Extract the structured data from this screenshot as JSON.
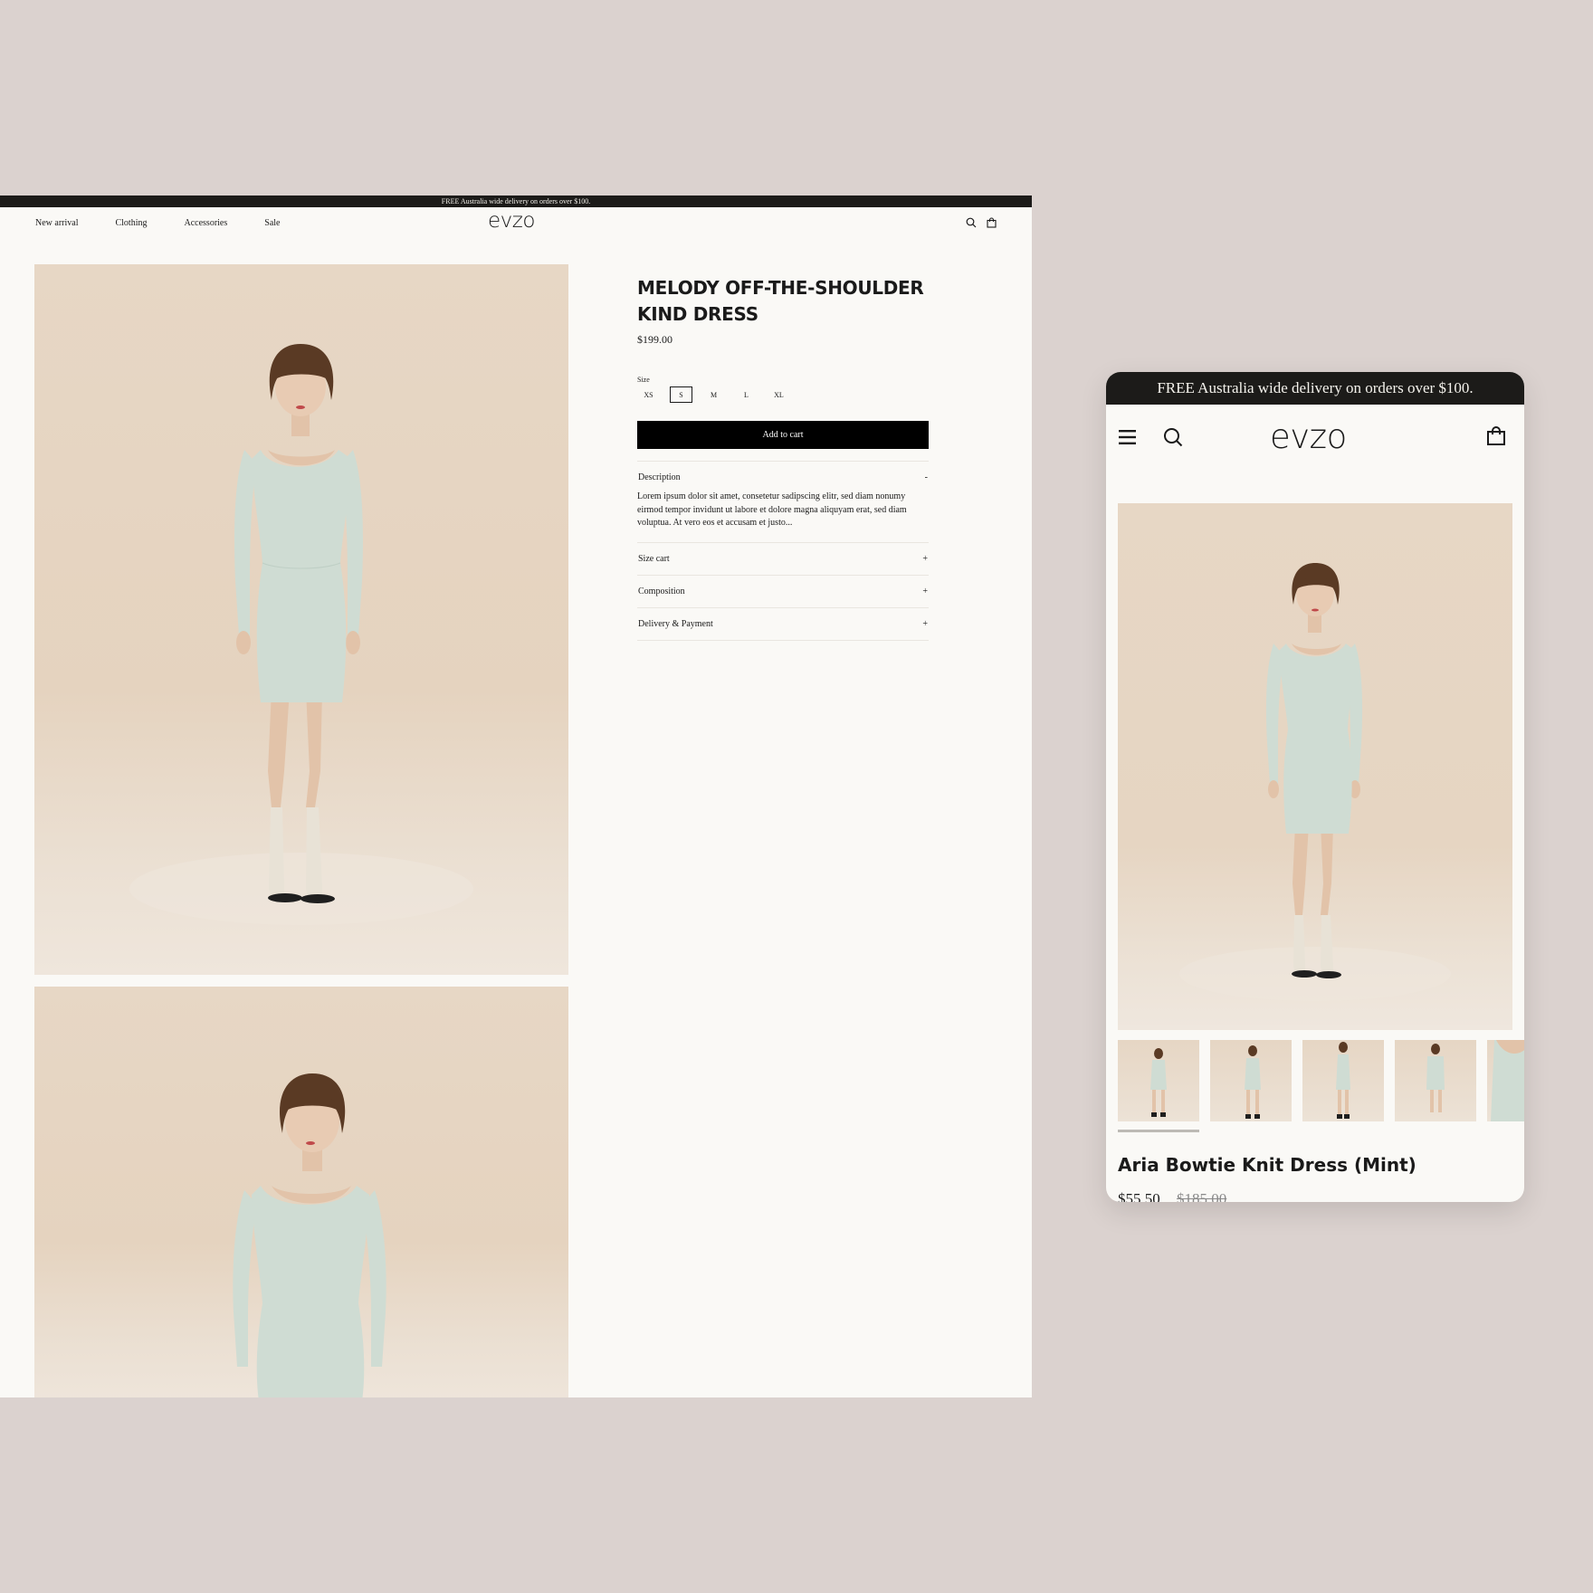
{
  "desktop": {
    "announcement": "FREE Australia wide delivery on orders over $100.",
    "nav": [
      {
        "label": "New arrival"
      },
      {
        "label": "Clothing"
      },
      {
        "label": "Accessories"
      },
      {
        "label": "Sale"
      }
    ],
    "logo": "evzo",
    "icons": [
      "search-icon",
      "bag-icon"
    ],
    "product": {
      "title": "MELODY OFF-THE-SHOULDER KIND DRESS",
      "price": "$199.00",
      "size_label": "Size",
      "sizes": [
        "XS",
        "S",
        "M",
        "L",
        "XL"
      ],
      "selected_size": "S",
      "add_to_cart": "Add to cart",
      "accordion": [
        {
          "label": "Description",
          "toggle": "-",
          "body": "Lorem ipsum dolor sit amet, consetetur sadipscing elitr, sed diam nonumy eirmod tempor invidunt ut labore et dolore magna aliquyam erat, sed diam voluptua. At vero eos et accusam et justo..."
        },
        {
          "label": "Size cart",
          "toggle": "+"
        },
        {
          "label": "Composition",
          "toggle": "+"
        },
        {
          "label": "Delivery &  Payment",
          "toggle": "+"
        }
      ]
    }
  },
  "mobile": {
    "announcement": "FREE Australia wide delivery on orders over $100.",
    "logo": "evzo",
    "icons": [
      "menu-icon",
      "search-icon",
      "bag-icon"
    ],
    "product": {
      "title": "Aria Bowtie Knit Dress (Mint)",
      "price": "$55.50",
      "compare_price": "$185.00"
    },
    "thumbnail_count": 5
  },
  "colors": {
    "background": "#dbd2cf",
    "page": "#faf9f6",
    "announcement_bar": "#1c1b19",
    "button": "#000000",
    "photo_backdrop": "#e7d7c5",
    "dress": "#cfdcd3"
  }
}
